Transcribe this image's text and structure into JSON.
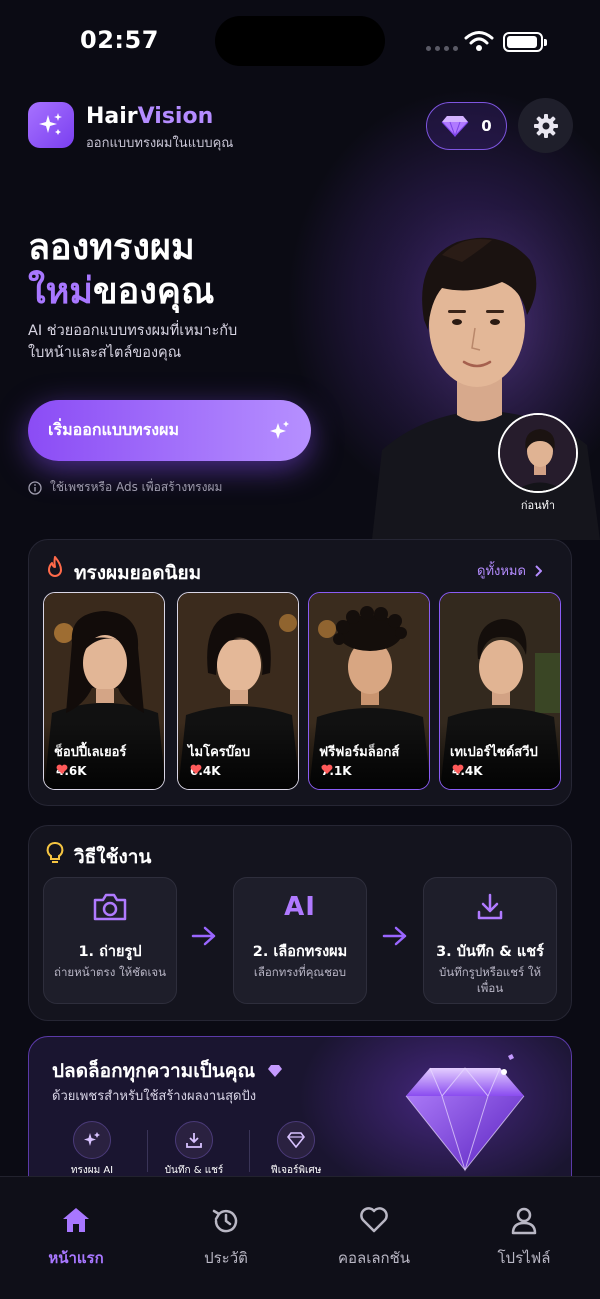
{
  "status_bar": {
    "time": "02:57"
  },
  "header": {
    "brand_part1": "Hair",
    "brand_part2": "Vision",
    "tagline": "ออกแบบทรงผมในแบบคุณ",
    "gem_count": "0"
  },
  "hero": {
    "title_line1": "ลองทรงผม",
    "title_highlight": "ใหม่",
    "title_rest": "ของคุณ",
    "subtitle": "AI ช่วยออกแบบทรงผมที่เหมาะกับใบหน้าและสไตล์ของคุณ",
    "cta_label": "เริ่มออกแบบทรงผม",
    "hint": "ใช้เพชรหรือ Ads เพื่อสร้างทรงผม",
    "before_label": "ก่อนทำ"
  },
  "popular": {
    "title": "ทรงผมยอดนิยม",
    "see_all": "ดูทั้งหมด",
    "items": [
      {
        "name": "ช็อปปี้เลเยอร์",
        "likes": "4.6K"
      },
      {
        "name": "ไมโครบ๊อบ",
        "likes": "6.4K"
      },
      {
        "name": "ฟรีฟอร์มล็อกส์",
        "likes": "7.1K"
      },
      {
        "name": "เทเปอร์ไซด์สวีป",
        "likes": "4.4K"
      }
    ]
  },
  "how_to": {
    "title": "วิธีใช้งาน",
    "steps": [
      {
        "title": "1. ถ่ายรูป",
        "desc": "ถ่ายหน้าตรง ให้ชัดเจน",
        "icon": "camera-icon"
      },
      {
        "title": "2. เลือกทรงผม",
        "desc": "เลือกทรงที่คุณชอบ",
        "icon": "ai-icon",
        "icon_text": "AI"
      },
      {
        "title": "3. บันทึก & แชร์",
        "desc": "บันทึกรูปหรือแชร์ ให้เพื่อน",
        "icon": "download-icon"
      }
    ]
  },
  "premium": {
    "title": "ปลดล็อกทุกความเป็นคุณ",
    "subtitle": "ด้วยเพชรสำหรับใช้สร้างผลงานสุดปัง",
    "features": [
      {
        "label": "ทรงผม AI",
        "icon": "sparkle-icon"
      },
      {
        "label": "บันทึก & แชร์",
        "icon": "download-icon"
      },
      {
        "label": "ฟีเจอร์พิเศษ",
        "icon": "diamond-icon"
      }
    ]
  },
  "tabbar": {
    "items": [
      {
        "label": "หน้าแรก",
        "icon": "home-icon",
        "active": true
      },
      {
        "label": "ประวัติ",
        "icon": "history-icon",
        "active": false
      },
      {
        "label": "คอลเลกชัน",
        "icon": "heart-icon",
        "active": false
      },
      {
        "label": "โปรไฟล์",
        "icon": "profile-icon",
        "active": false
      }
    ]
  },
  "colors": {
    "accent": "#a877ff",
    "accent_dark": "#8b4cf5",
    "background": "#0b0b14",
    "card": "#14141e",
    "like_red": "#ff5a5a"
  }
}
